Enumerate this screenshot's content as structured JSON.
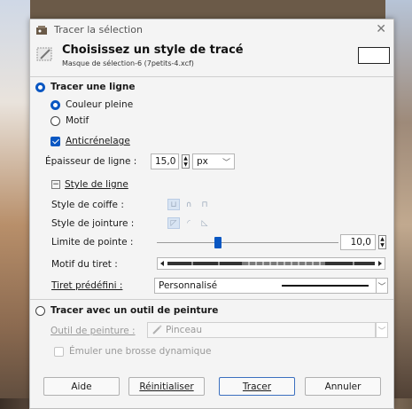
{
  "window": {
    "title": "Tracer la sélection",
    "close": "✕"
  },
  "header": {
    "title": "Choisissez un style de tracé",
    "subtitle": "Masque de sélection-6 (7petits-4.xcf)"
  },
  "stroke_line": {
    "label": "Tracer une ligne",
    "solid_color": "Couleur pleine",
    "pattern": "Motif",
    "antialiasing": "Anticrénelage",
    "line_width_label": "Épaisseur de ligne :",
    "line_width_value": "15,0",
    "unit": "px",
    "line_style": {
      "label": "Style de ligne",
      "cap_label": "Style de coiffe :",
      "join_label": "Style de jointure :",
      "miter_label": "Limite de pointe :",
      "miter_value": "10,0",
      "miter_fraction": 0.33,
      "dash_pattern_label": "Motif du tiret :",
      "dash_preset_label": "Tiret prédéfini :",
      "dash_preset_value": "Personnalisé"
    }
  },
  "stroke_tool": {
    "label": "Tracer avec un outil de peinture",
    "paint_tool_label": "Outil de peinture :",
    "paint_tool_value": "Pinceau",
    "emulate": "Émuler une brosse dynamique"
  },
  "buttons": {
    "help": "Aide",
    "reset": "Réinitialiser",
    "stroke": "Tracer",
    "cancel": "Annuler"
  },
  "colors": {
    "accent": "#0a57c2"
  }
}
